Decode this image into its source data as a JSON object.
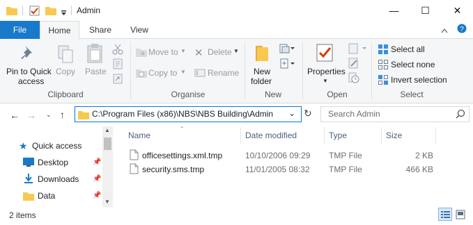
{
  "window": {
    "title": "Admin"
  },
  "window_controls": {
    "minimize": "—",
    "maximize": "☐",
    "close": "✕"
  },
  "tabs": {
    "file": "File",
    "home": "Home",
    "share": "Share",
    "view": "View"
  },
  "ribbon": {
    "clipboard": {
      "pin_label_1": "Pin to Quick",
      "pin_label_2": "access",
      "copy": "Copy",
      "paste": "Paste",
      "group": "Clipboard"
    },
    "organise": {
      "move_to": "Move to",
      "copy_to": "Copy to",
      "delete": "Delete",
      "rename": "Rename",
      "group": "Organise"
    },
    "new": {
      "label_1": "New",
      "label_2": "folder",
      "group": "New"
    },
    "open": {
      "properties": "Properties",
      "group": "Open"
    },
    "select": {
      "select_all": "Select all",
      "select_none": "Select none",
      "invert": "Invert selection",
      "group": "Select"
    }
  },
  "address": {
    "path": "C:\\Program Files (x86)\\NBS\\NBS Building\\Admin"
  },
  "search": {
    "placeholder": "Search Admin"
  },
  "nav_pane": {
    "items": [
      {
        "label": "Quick access",
        "icon": "star-icon"
      },
      {
        "label": "Desktop",
        "icon": "desktop-icon"
      },
      {
        "label": "Downloads",
        "icon": "download-icon"
      },
      {
        "label": "Data",
        "icon": "folder-icon"
      }
    ]
  },
  "columns": {
    "name": "Name",
    "date": "Date modified",
    "type": "Type",
    "size": "Size"
  },
  "files": [
    {
      "name": "officesettings.xml.tmp",
      "date": "10/10/2006 09:29",
      "type": "TMP File",
      "size": "2 KB"
    },
    {
      "name": "security.sms.tmp",
      "date": "11/01/2005 08:32",
      "type": "TMP File",
      "size": "466 KB"
    }
  ],
  "status": {
    "count": "2 items"
  },
  "colors": {
    "accent": "#1979ca",
    "folder": "#f7c94f",
    "ribbon_bg": "#f5f6f7"
  }
}
